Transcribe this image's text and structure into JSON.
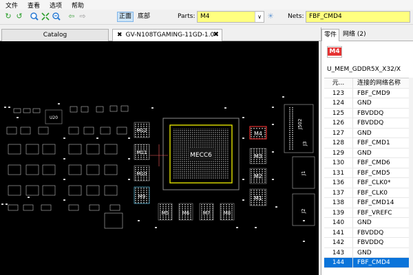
{
  "menu": [
    "文件",
    "查看",
    "选项",
    "帮助"
  ],
  "toolbar": {
    "front_label": "正面",
    "back_label": "底部",
    "parts_label": "Parts:",
    "parts_value": "M4",
    "nets_label": "Nets:",
    "nets_value": "FBF_CMD4",
    "icons": [
      "refresh-icon",
      "refresh-alt-icon",
      "zoom-in-icon",
      "zoom-fit-icon",
      "zoom-out-icon",
      "back-arrow-icon",
      "forward-arrow-icon",
      "bulb-icon"
    ]
  },
  "tabs": {
    "catalog": "Catalog",
    "board": "GV-N108TGAMING-11GD-1.0"
  },
  "board": {
    "gpu_label": "MECC6",
    "components": [
      "M4",
      "M3",
      "M2",
      "M1",
      "M12",
      "M11",
      "M10",
      "M9",
      "M5",
      "M6",
      "M7",
      "M8",
      "J502",
      "J3",
      "J1",
      "J2",
      "U20"
    ]
  },
  "panel": {
    "tab_parts": "零件",
    "tab_nets": "网络 (2)",
    "part_button": "M4",
    "description": "U_MEM_GDDR5X_X32/X",
    "col_pin": "元...",
    "col_net": "连接的网络名称",
    "rows": [
      {
        "pin": "123",
        "net": "FBF_CMD9"
      },
      {
        "pin": "124",
        "net": "GND"
      },
      {
        "pin": "125",
        "net": "FBVDDQ"
      },
      {
        "pin": "126",
        "net": "FBVDDQ"
      },
      {
        "pin": "127",
        "net": "GND"
      },
      {
        "pin": "128",
        "net": "FBF_CMD1"
      },
      {
        "pin": "129",
        "net": "GND"
      },
      {
        "pin": "130",
        "net": "FBF_CMD6"
      },
      {
        "pin": "131",
        "net": "FBF_CMD5"
      },
      {
        "pin": "136",
        "net": "FBF_CLK0*"
      },
      {
        "pin": "137",
        "net": "FBF_CLK0"
      },
      {
        "pin": "138",
        "net": "FBF_CMD14"
      },
      {
        "pin": "139",
        "net": "FBF_VREFC"
      },
      {
        "pin": "140",
        "net": "GND"
      },
      {
        "pin": "141",
        "net": "FBVDDQ"
      },
      {
        "pin": "142",
        "net": "FBVDDQ"
      },
      {
        "pin": "143",
        "net": "GND"
      },
      {
        "pin": "144",
        "net": "FBF_CMD4"
      }
    ],
    "selected_pin": "144"
  },
  "colors": {
    "input_bg": "#ffff80",
    "selection": "#0a74da",
    "highlight_red": "#e53333",
    "board_bg": "#000000",
    "gpu_outline": "#e0e000"
  }
}
